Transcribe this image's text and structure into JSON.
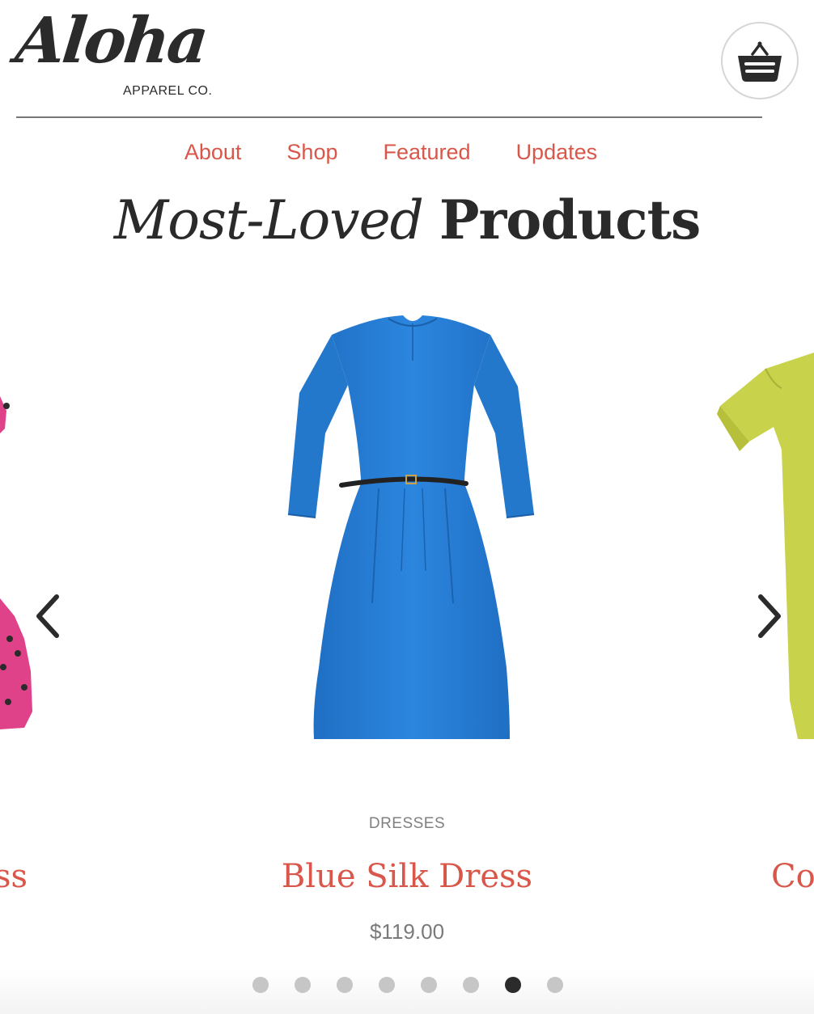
{
  "brand": {
    "logo_script": "Aloha",
    "logo_sub": "APPAREL CO."
  },
  "header": {
    "cart_icon": "shopping-basket-icon"
  },
  "nav": {
    "items": [
      {
        "label": "About"
      },
      {
        "label": "Shop"
      },
      {
        "label": "Featured"
      },
      {
        "label": "Updates"
      }
    ]
  },
  "section": {
    "title_italic": "Most-Loved",
    "title_bold": "Products"
  },
  "carousel": {
    "current": {
      "category": "DRESSES",
      "name": "Blue Silk Dress",
      "price": "$119.00",
      "image": "blue-dress-image"
    },
    "prev": {
      "name_visible": "ss",
      "image": "pink-polka-dot-dress-image"
    },
    "next": {
      "name_visible": "Co",
      "image": "yellow-green-top-image"
    },
    "dots_count": 8,
    "active_dot": 7
  },
  "colors": {
    "accent": "#d9574a",
    "text_dark": "#2b2b2b",
    "muted": "#808080",
    "dress_blue": "#2a7fd4",
    "dress_pink": "#e0428a",
    "top_yellow": "#c8d24a"
  }
}
